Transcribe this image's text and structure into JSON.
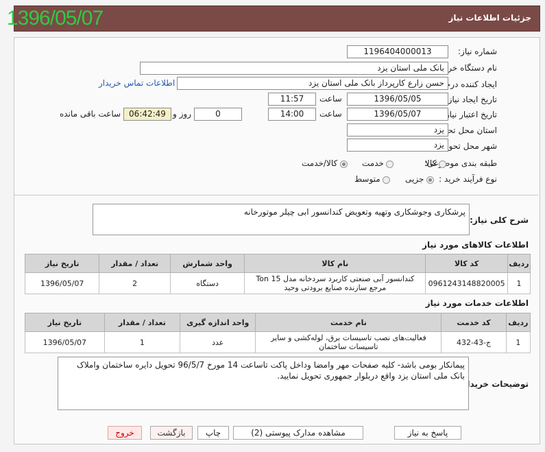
{
  "stamp_date": "1396/05/07",
  "header": {
    "title": "جزئیات اطلاعات نیاز"
  },
  "form": {
    "need_number_label": "شماره نیاز:",
    "need_number": "1196404000013",
    "buyer_label": "نام دستگاه خریدار:",
    "buyer": "بانک ملی استان یزد",
    "requester_label": "ایجاد کننده درخواست:",
    "requester": "حسن زارع کارپرداز بانک ملی استان یزد",
    "contact_link": "اطلاعات تماس خریدار",
    "created_label": "تاریخ ایجاد نیاز:",
    "created_date": "1396/05/05",
    "time_label": "ساعت",
    "created_time": "11:57",
    "valid_label": "تاریخ اعتبار نیاز:",
    "valid_date": "1396/05/07",
    "valid_time": "14:00",
    "days": "0",
    "days_label": "روز و",
    "remaining": "06:42:49",
    "remaining_label": "ساعت باقی مانده",
    "province_label": "استان محل تحویل:",
    "province": "یزد",
    "city_label": "شهر محل تحویل:",
    "city": "یزد",
    "category_label": "طبقه بندی موضوعی:",
    "category_options": [
      "کالا",
      "خدمت",
      "کالا/خدمت"
    ],
    "process_label": "نوع فرآیند خرید :",
    "process_options": [
      "جزیی",
      "متوسط"
    ]
  },
  "summary": {
    "label": "شرح کلی نیاز:",
    "text": "پرشکاری وجوشکاری وتهیه وتعویض کندانسور ابی چیلر موتورخانه"
  },
  "goods": {
    "title": "اطلاعات کالاهای مورد نیاز",
    "columns": [
      "ردیف",
      "کد کالا",
      "نام کالا",
      "واحد شمارش",
      "تعداد / مقدار",
      "تاریخ نیاز"
    ],
    "rows": [
      [
        "1",
        "0961243148820005",
        "کندانسور آبی صنعتی کاربرد سردخانه مدل Ton 15 مرجع سازنده صنایع برودتی وحید",
        "دستگاه",
        "2",
        "1396/05/07"
      ]
    ]
  },
  "services": {
    "title": "اطلاعات خدمات مورد نیاز",
    "columns": [
      "ردیف",
      "کد خدمت",
      "نام خدمت",
      "واحد اندازه گیری",
      "تعداد / مقدار",
      "تاریخ نیاز"
    ],
    "rows": [
      [
        "1",
        "ج-43-432",
        "فعالیت‌های نصب تاسیسات برق، لوله‌کشی و سایر تاسیسات ساختمان",
        "عدد",
        "1",
        "1396/05/07"
      ]
    ]
  },
  "notes": {
    "label": "توضیحات خریدار:",
    "text": "پیمانکار بومی باشد- کلیه صفحات مهر وامضا وداخل پاکت تاساعت 14 مورخ 96/5/7 تحویل دایره ساختمان واملاک بانک ملی استان یزد واقع دربلوار جمهوری تحویل نمایید."
  },
  "buttons": {
    "reply": "پاسخ به نیاز",
    "attachments": "مشاهده مدارک پیوستی (2)",
    "print": "چاپ",
    "back": "بازگشت",
    "exit": "خروج"
  },
  "colors": {
    "header_bg": "#7a4a47",
    "stamp": "#2ecc40",
    "exit": "#cc0000"
  }
}
